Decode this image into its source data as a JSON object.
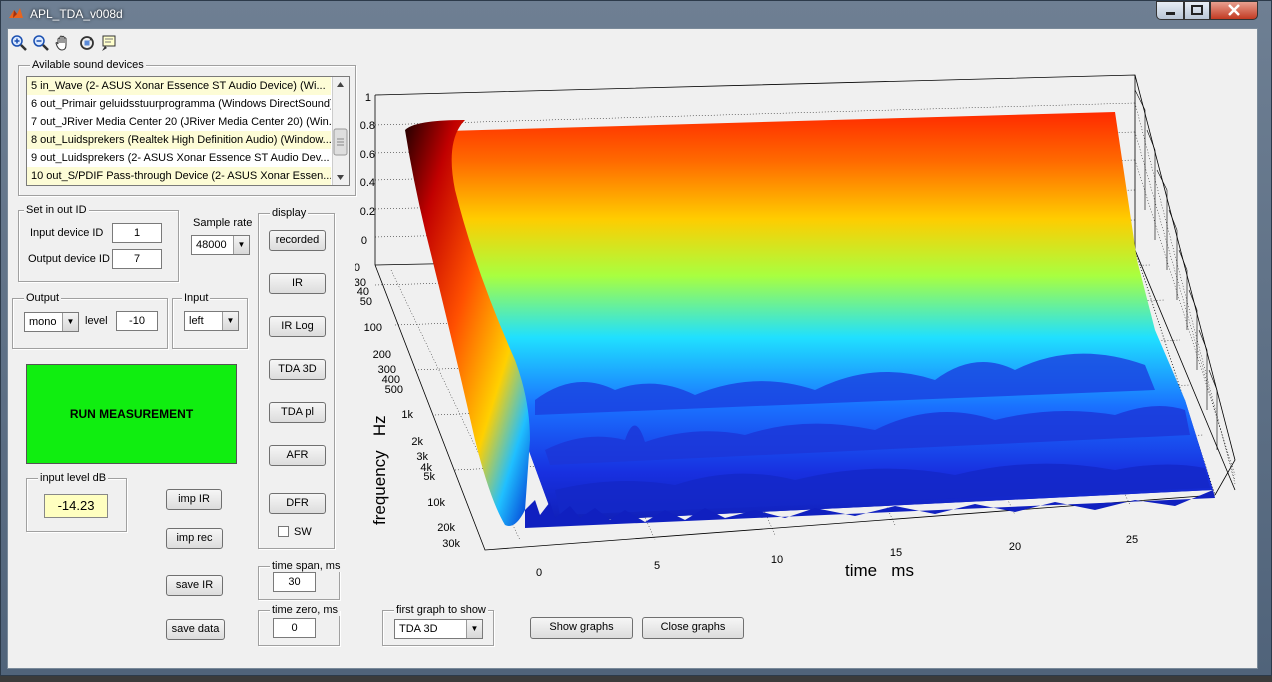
{
  "window": {
    "title": "APL_TDA_v008d"
  },
  "colors": {
    "run_button": "#10ee10",
    "level_bg": "#ffffc0",
    "list_highlight": "#fdfcd6"
  },
  "toolbar": {
    "icons": [
      "zoom-in-icon",
      "zoom-out-icon",
      "pan-hand-icon",
      "rotate-3d-icon",
      "data-cursor-icon"
    ]
  },
  "devices": {
    "legend": "Avilable sound devices",
    "items": [
      "5 in_Wave (2- ASUS Xonar Essence ST Audio Device) (Wi...",
      "6 out_Primair geluidsstuurprogramma (Windows DirectSound)",
      "7 out_JRiver Media Center 20 (JRiver Media Center 20) (Win...",
      "8 out_Luidsprekers (Realtek High Definition Audio) (Window...",
      "9 out_Luidsprekers (2- ASUS Xonar Essence ST Audio Dev...",
      "10 out_S/PDIF Pass-through Device (2- ASUS Xonar Essen..."
    ]
  },
  "io_id": {
    "legend": "Set in out ID",
    "input_label": "Input device ID",
    "input_value": "1",
    "output_label": "Output device ID",
    "output_value": "7"
  },
  "sample_rate": {
    "label": "Sample rate",
    "value": "48000"
  },
  "output": {
    "legend": "Output",
    "mode": "mono",
    "level_label": "level",
    "level_value": "-10"
  },
  "input": {
    "legend": "Input",
    "channel": "left"
  },
  "run": {
    "label": "RUN MEASUREMENT"
  },
  "input_level": {
    "legend": "input level dB",
    "value": "-14.23"
  },
  "file_buttons": {
    "imp_ir": "imp IR",
    "imp_rec": "imp rec",
    "save_ir": "save IR",
    "save_data": "save data"
  },
  "display": {
    "legend": "display",
    "buttons": [
      "recorded",
      "IR",
      "IR Log",
      "TDA 3D",
      "TDA pl",
      "AFR",
      "DFR"
    ],
    "sw_label": "SW"
  },
  "time_span": {
    "legend": "time span, ms",
    "value": "30"
  },
  "time_zero": {
    "legend": "time zero, ms",
    "value": "0"
  },
  "first_graph": {
    "legend": "first graph to show",
    "value": "TDA 3D"
  },
  "actions": {
    "show": "Show graphs",
    "close": "Close graphs"
  },
  "chart_data": {
    "type": "surface-3d",
    "xlabel": "time   ms",
    "ylabel": "frequency   Hz",
    "x_ticks": [
      "0",
      "5",
      "10",
      "15",
      "20",
      "25"
    ],
    "y_ticks": [
      "20",
      "30",
      "40",
      "50",
      "100",
      "200",
      "300",
      "400",
      "500",
      "1k",
      "2k",
      "3k",
      "4k",
      "5k",
      "10k",
      "20k",
      "30k"
    ],
    "z_ticks": [
      "0",
      "0.2",
      "0.4",
      "0.6",
      "0.8",
      "1"
    ],
    "xlim": [
      0,
      30
    ],
    "ylim": [
      20,
      30000
    ],
    "zlim": [
      0,
      1
    ],
    "y_scale": "log",
    "colormap": "jet",
    "grid": "dotted"
  }
}
